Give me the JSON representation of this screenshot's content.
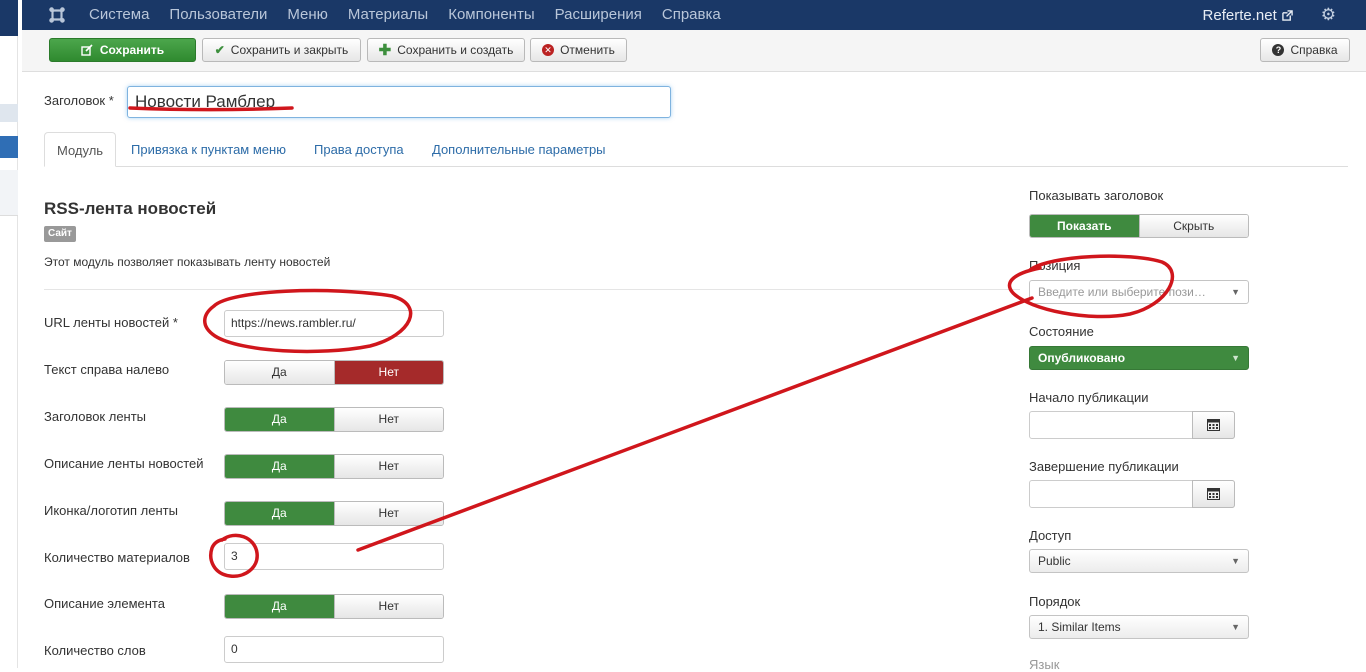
{
  "navbar": {
    "menu": [
      "Система",
      "Пользователи",
      "Меню",
      "Материалы",
      "Компоненты",
      "Расширения",
      "Справка"
    ],
    "site_link": "Referte.net"
  },
  "toolbar": {
    "save": "Сохранить",
    "save_close": "Сохранить и закрыть",
    "save_new": "Сохранить и создать",
    "cancel": "Отменить",
    "help": "Справка"
  },
  "title_field": {
    "label": "Заголовок *",
    "value": "Новости Рамблер"
  },
  "tabs": [
    "Модуль",
    "Привязка к пунктам меню",
    "Права доступа",
    "Дополнительные параметры"
  ],
  "module": {
    "name": "RSS-лента новостей",
    "badge": "Сайт",
    "description": "Этот модуль позволяет показывать ленту новостей"
  },
  "fields": {
    "url": {
      "label": "URL ленты новостей *",
      "value": "https://news.rambler.ru/"
    },
    "rtl": {
      "label": "Текст справа налево",
      "yes": "Да",
      "no": "Нет"
    },
    "feed_title": {
      "label": "Заголовок ленты",
      "yes": "Да",
      "no": "Нет"
    },
    "feed_desc": {
      "label": "Описание ленты новостей",
      "yes": "Да",
      "no": "Нет"
    },
    "feed_image": {
      "label": "Иконка/логотип ленты",
      "yes": "Да",
      "no": "Нет"
    },
    "items": {
      "label": "Количество материалов",
      "value": "3"
    },
    "item_desc": {
      "label": "Описание элемента",
      "yes": "Да",
      "no": "Нет"
    },
    "words": {
      "label": "Количество слов",
      "value": "0"
    }
  },
  "sidebar": {
    "show_title": {
      "label": "Показывать заголовок",
      "show": "Показать",
      "hide": "Скрыть"
    },
    "position": {
      "label": "Позиция",
      "placeholder": "Введите или выберите пози…"
    },
    "status": {
      "label": "Состояние",
      "value": "Опубликовано"
    },
    "publish_up": {
      "label": "Начало публикации"
    },
    "publish_down": {
      "label": "Завершение публикации"
    },
    "access": {
      "label": "Доступ",
      "value": "Public"
    },
    "ordering": {
      "label": "Порядок",
      "value": "1. Similar Items"
    },
    "language": {
      "label": "Язык"
    }
  },
  "colors": {
    "navbar": "#1a3867",
    "success": "#3f8a3f",
    "danger": "#a52a2a",
    "annotation": "#d0161c"
  }
}
